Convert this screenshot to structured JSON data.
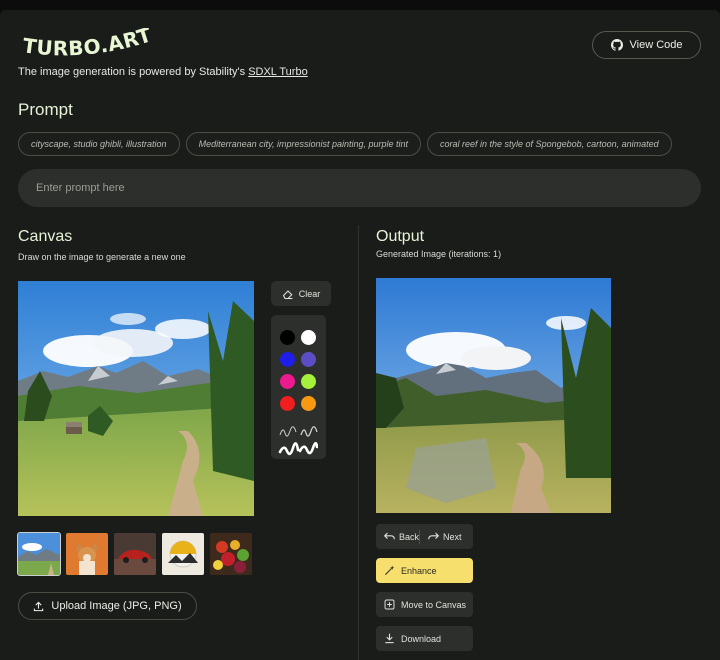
{
  "header": {
    "logo_text": "TURBO.ART",
    "subtitle_prefix": "The image generation is powered by Stability's",
    "subtitle_link": "SDXL Turbo",
    "view_code_label": "View Code",
    "view_code_icon": "github-icon"
  },
  "prompt": {
    "heading": "Prompt",
    "examples": [
      "cityscape, studio ghibli, illustration",
      "Mediterranean city, impressionist painting, purple tint",
      "coral reef in the style of Spongebob, cartoon, animated"
    ],
    "placeholder": "Enter prompt here",
    "value": ""
  },
  "canvas": {
    "heading": "Canvas",
    "description": "Draw on the image to generate a new one",
    "clear_label": "Clear",
    "clear_icon": "eraser-icon",
    "colors": [
      "#000000",
      "#ffffff",
      "#1e1ee8",
      "#5b4ec4",
      "#ec1a8e",
      "#a4f03a",
      "#f01e1e",
      "#f79a12"
    ],
    "brushes": [
      "thin-stroke",
      "medium-stroke",
      "thick-stroke"
    ],
    "thumbnails": [
      "mountain-landscape",
      "corgi-dog",
      "red-car",
      "mountain-sun-art",
      "fruit-bowl"
    ],
    "selected_thumbnail": 0,
    "upload_label": "Upload Image (JPG, PNG)",
    "upload_icon": "upload-icon"
  },
  "output": {
    "heading": "Output",
    "description": "Generated Image (iterations: 1)",
    "back_label": "Back",
    "next_label": "Next",
    "enhance_label": "Enhance",
    "move_label": "Move to Canvas",
    "download_label": "Download"
  },
  "colors": {
    "background": "#1a1c1a",
    "surface": "#2c2f2b",
    "heading": "#e6f3d7",
    "enhance": "#f6df6d"
  }
}
